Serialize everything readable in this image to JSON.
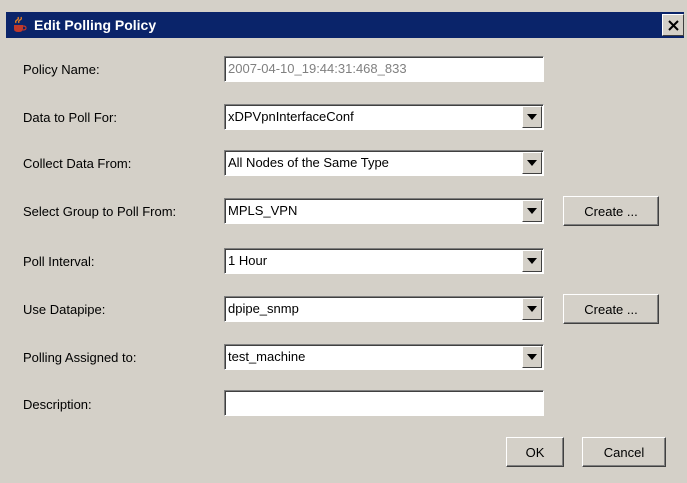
{
  "window": {
    "title": "Edit Polling Policy",
    "close_glyph": "✕"
  },
  "form": {
    "policy_name": {
      "label": "Policy Name:",
      "value": "2007-04-10_19:44:31:468_833"
    },
    "data_to_poll": {
      "label": "Data to Poll For:",
      "value": "xDPVpnInterfaceConf"
    },
    "collect_from": {
      "label": "Collect Data From:",
      "value": "All Nodes of the Same Type"
    },
    "group": {
      "label": "Select Group to Poll From:",
      "value": "MPLS_VPN"
    },
    "interval": {
      "label": "Poll Interval:",
      "value": "1 Hour"
    },
    "datapipe": {
      "label": "Use Datapipe:",
      "value": "dpipe_snmp"
    },
    "assigned": {
      "label": "Polling Assigned to:",
      "value": "test_machine"
    },
    "description": {
      "label": "Description:",
      "value": ""
    }
  },
  "buttons": {
    "create_group": "Create ...",
    "create_datapipe": "Create ...",
    "ok": "OK",
    "cancel": "Cancel"
  },
  "icons": {
    "app": "java-cup-icon",
    "dropdown": "chevron-down-icon",
    "close": "close-icon"
  },
  "colors": {
    "titlebar": "#0a246a",
    "background": "#d4d0c8",
    "disabled_text": "#808080"
  }
}
